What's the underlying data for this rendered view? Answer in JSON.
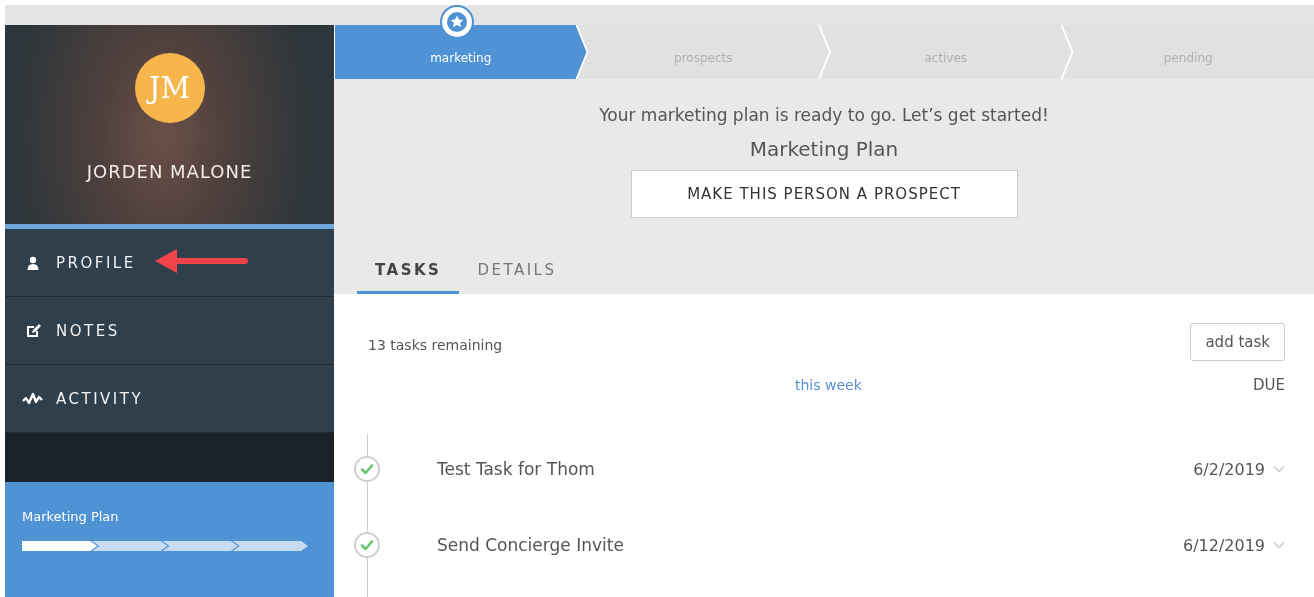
{
  "user": {
    "initials": "JM",
    "name": "JORDEN MALONE"
  },
  "nav": [
    {
      "label": "PROFILE",
      "kind": "person"
    },
    {
      "label": "NOTES",
      "kind": "edit"
    },
    {
      "label": "ACTIVITY",
      "kind": "pulse"
    }
  ],
  "plan_card": {
    "title": "Marketing Plan",
    "steps": [
      {
        "complete": true
      },
      {
        "complete": false
      },
      {
        "complete": false
      },
      {
        "complete": false
      }
    ]
  },
  "stages": [
    {
      "label": "marketing",
      "selected": true
    },
    {
      "label": "prospects",
      "selected": false
    },
    {
      "label": "actives",
      "selected": false
    },
    {
      "label": "pending",
      "selected": false
    }
  ],
  "banner": {
    "message": "Your marketing plan is ready to go. Let’s get started!",
    "plan": "Marketing Plan",
    "action": "MAKE THIS PERSON A PROSPECT"
  },
  "tabs": [
    {
      "label": "TASKS",
      "selected": true
    },
    {
      "label": "DETAILS",
      "selected": false
    }
  ],
  "tasks": {
    "remaining": "13 tasks remaining",
    "add_button": "add task",
    "group": "this week",
    "due_header": "DUE",
    "items": [
      {
        "title": "Test Task for Thom",
        "due": "6/2/2019",
        "done": true
      },
      {
        "title": "Send Concierge Invite",
        "due": "6/12/2019",
        "done": true
      }
    ]
  }
}
